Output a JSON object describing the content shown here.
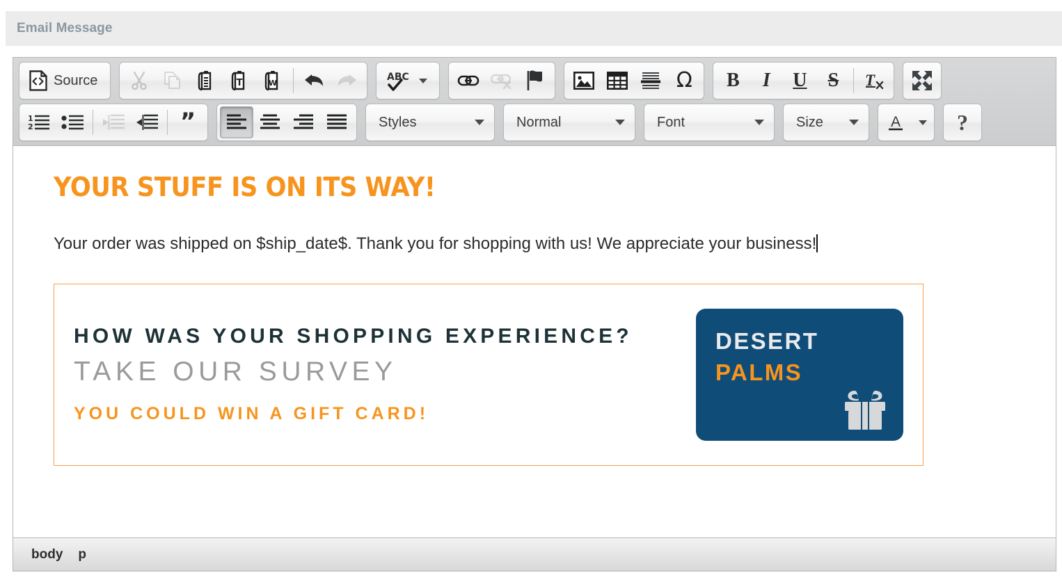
{
  "panel": {
    "title": "Email Message"
  },
  "toolbar": {
    "row1": {
      "source_label": "Source",
      "source_icon": "source-code-icon",
      "clipboard": [
        {
          "name": "cut",
          "icon": "scissors-icon",
          "disabled": true
        },
        {
          "name": "copy",
          "icon": "copy-pages-icon",
          "disabled": true
        },
        {
          "name": "paste",
          "icon": "clipboard-icon",
          "disabled": false
        },
        {
          "name": "paste-as-plain-text",
          "icon": "clipboard-text-icon",
          "disabled": false
        },
        {
          "name": "paste-from-word",
          "icon": "clipboard-word-icon",
          "disabled": false
        }
      ],
      "history": [
        {
          "name": "undo",
          "icon": "undo-arrow-icon",
          "disabled": false
        },
        {
          "name": "redo",
          "icon": "redo-arrow-icon",
          "disabled": true
        }
      ],
      "spellcheck": {
        "name": "spell-check",
        "label": "ABC",
        "icon": "abc-checkmark-icon"
      },
      "links": [
        {
          "name": "link",
          "icon": "chain-link-icon",
          "disabled": false
        },
        {
          "name": "unlink",
          "icon": "broken-chain-icon",
          "disabled": true
        },
        {
          "name": "anchor",
          "icon": "flag-icon",
          "disabled": false
        }
      ],
      "insert": [
        {
          "name": "image",
          "icon": "picture-icon",
          "disabled": false
        },
        {
          "name": "table",
          "icon": "table-grid-icon",
          "disabled": false
        },
        {
          "name": "horizontal-rule",
          "icon": "horizontal-line-icon",
          "disabled": false
        },
        {
          "name": "special-character",
          "icon": "omega-icon",
          "glyph": "Ω",
          "disabled": false
        }
      ],
      "basic_styles": [
        {
          "name": "bold",
          "glyph": "B",
          "disabled": false
        },
        {
          "name": "italic",
          "glyph": "I",
          "disabled": false
        },
        {
          "name": "underline",
          "glyph": "U",
          "disabled": false
        },
        {
          "name": "strikethrough",
          "glyph": "S",
          "disabled": false
        },
        {
          "name": "remove-format",
          "glyph": "Tx",
          "disabled": false
        }
      ],
      "maximize": {
        "name": "maximize",
        "icon": "four-arrows-expand-icon"
      }
    },
    "row2": {
      "lists": [
        {
          "name": "numbered-list",
          "icon": "numbered-list-icon",
          "disabled": false
        },
        {
          "name": "bulleted-list",
          "icon": "bulleted-list-icon",
          "disabled": false
        }
      ],
      "indent": [
        {
          "name": "decrease-indent",
          "icon": "outdent-icon",
          "disabled": true
        },
        {
          "name": "increase-indent",
          "icon": "indent-icon",
          "disabled": false
        }
      ],
      "blockquote": {
        "name": "blockquote",
        "icon": "quotation-marks-icon"
      },
      "align": [
        {
          "name": "align-left",
          "icon": "align-left-icon",
          "active": true
        },
        {
          "name": "align-center",
          "icon": "align-center-icon",
          "active": false
        },
        {
          "name": "align-right",
          "icon": "align-right-icon",
          "active": false
        },
        {
          "name": "justify",
          "icon": "align-justify-icon",
          "active": false
        }
      ],
      "styles_combo": {
        "name": "styles",
        "value": "Styles"
      },
      "format_combo": {
        "name": "paragraph-format",
        "value": "Normal"
      },
      "font_combo": {
        "name": "font-name",
        "value": "Font"
      },
      "size_combo": {
        "name": "font-size",
        "value": "Size"
      },
      "text_color": {
        "name": "text-color",
        "glyph": "A"
      },
      "help": {
        "name": "about-help",
        "glyph": "?"
      }
    }
  },
  "document": {
    "heading": "YOUR STUFF IS ON ITS WAY!",
    "paragraph": "Your order was shipped on $ship_date$. Thank you for shopping with us! We appreciate your business!",
    "banner": {
      "line1": "HOW WAS YOUR SHOPPING EXPERIENCE?",
      "line2": "TAKE OUR SURVEY",
      "line3": "YOU COULD WIN A GIFT CARD!",
      "gift_card": {
        "line1": "DESERT",
        "line2": "PALMS",
        "icon": "gift-box-icon"
      }
    }
  },
  "footer": {
    "elements_path": [
      "body",
      "p"
    ]
  },
  "colors": {
    "accent_orange": "#f7941e",
    "card_blue": "#0f4c78",
    "banner_dark": "#1d3237",
    "banner_grey": "#9a9a9a",
    "header_text": "#8a97a0"
  }
}
